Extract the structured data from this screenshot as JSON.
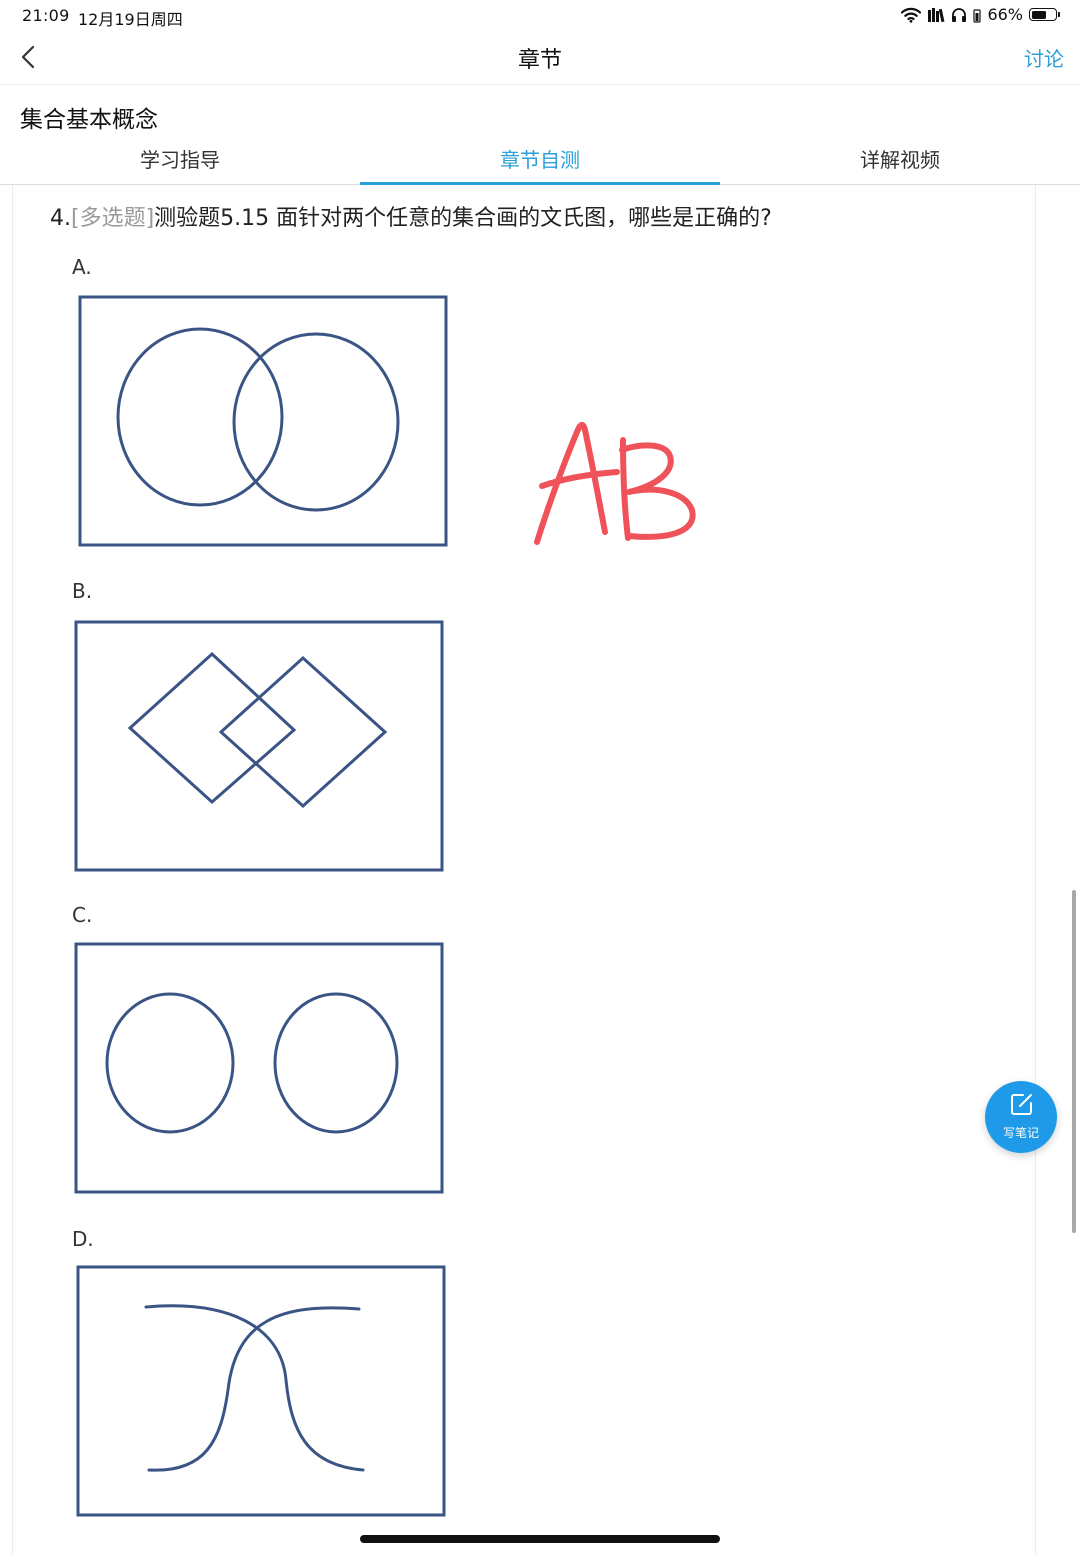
{
  "status_bar": {
    "time": "21:09",
    "date": "12月19日周四",
    "battery": "66%",
    "battery_level": 0.66
  },
  "nav": {
    "title": "章节",
    "action": "讨论"
  },
  "chapter_title": "集合基本概念",
  "tabs": [
    {
      "label": "学习指导",
      "active": false
    },
    {
      "label": "章节自测",
      "active": true
    },
    {
      "label": "详解视频",
      "active": false
    }
  ],
  "question": {
    "number": "4.",
    "type": "[多选题]",
    "text": "测验题5.15 面针对两个任意的集合画的文氏图，哪些是正确的?"
  },
  "options": [
    {
      "label": "A.",
      "figure": "two-overlapping-circles"
    },
    {
      "label": "B.",
      "figure": "two-overlapping-diamonds"
    },
    {
      "label": "C.",
      "figure": "two-separate-circles"
    },
    {
      "label": "D.",
      "figure": "two-crossing-curves"
    }
  ],
  "handwritten_answer": "AB",
  "floating_button": {
    "label": "写笔记",
    "icon": "edit-note-icon"
  },
  "colors": {
    "accent": "#2a9fd8",
    "figure_stroke": "#3a5585",
    "handwriting": "#f0525a",
    "fab": "#1f9ae8"
  }
}
